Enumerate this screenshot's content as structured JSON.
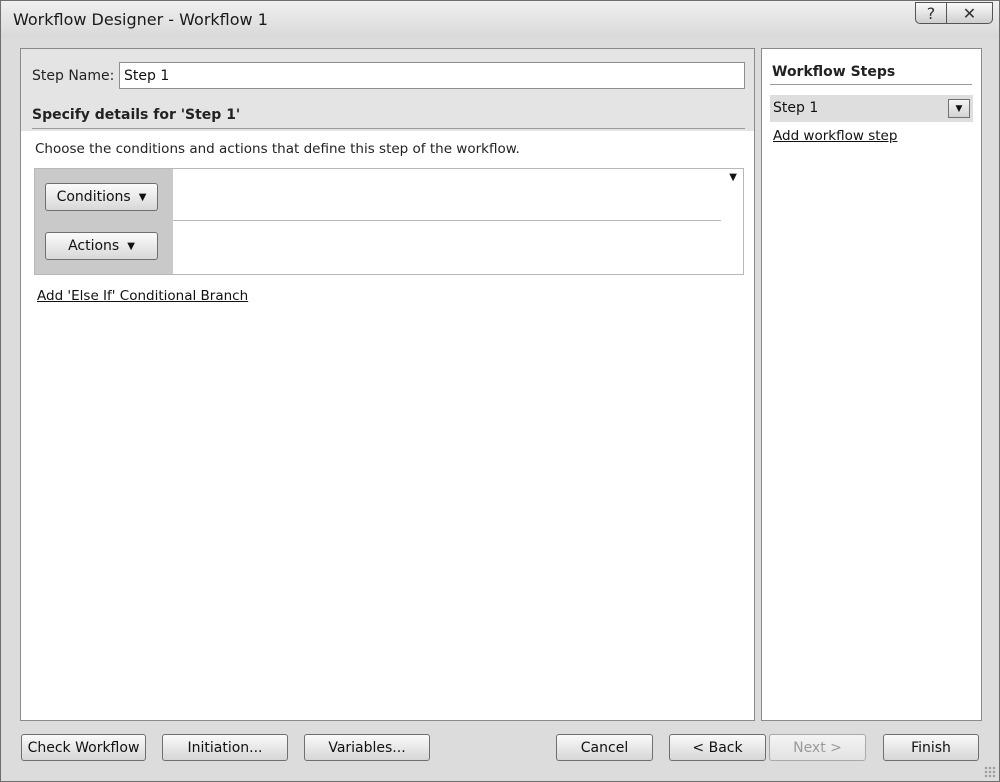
{
  "window": {
    "title": "Workflow Designer - Workflow 1",
    "help_glyph": "?",
    "close_glyph": "✕"
  },
  "main": {
    "step_name_label": "Step Name:",
    "step_name_value": "Step 1",
    "details_heading": "Specify details for 'Step 1'",
    "instructions": "Choose the conditions and actions that define this step of the workflow.",
    "conditions_label": "Conditions",
    "actions_label": "Actions",
    "dropdown_glyph": "▼",
    "else_if_link": "Add 'Else If' Conditional Branch"
  },
  "sidebar": {
    "heading": "Workflow Steps",
    "steps": [
      {
        "label": "Step 1"
      }
    ],
    "add_step_link": "Add workflow step"
  },
  "footer": {
    "check_workflow": "Check Workflow",
    "initiation": "Initiation...",
    "variables": "Variables...",
    "cancel": "Cancel",
    "back": "< Back",
    "next": "Next >",
    "finish": "Finish"
  },
  "icons": {
    "help": "help-icon",
    "close": "close-icon",
    "dropdown": "caret-down-icon",
    "resize": "resize-grip-icon"
  }
}
